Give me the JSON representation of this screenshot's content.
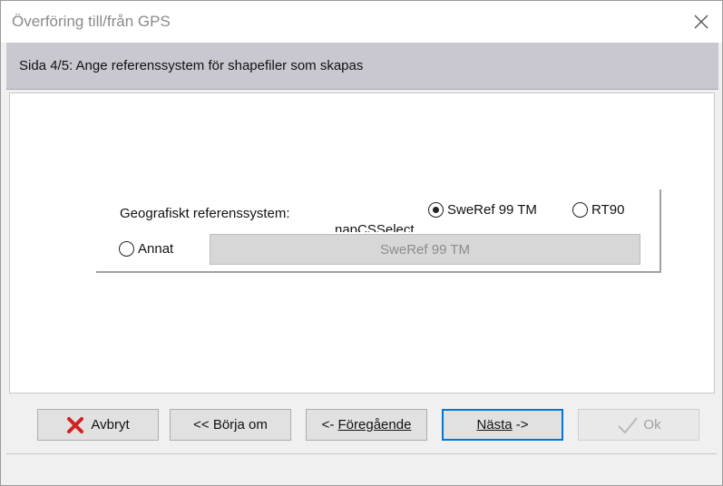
{
  "window": {
    "title": "Överföring till/från GPS"
  },
  "header": {
    "step_text": "Sida 4/5: Ange referenssystem för shapefiler som skapas"
  },
  "reference_group": {
    "label": "Geografiskt referenssystem:",
    "clipped_label": "napCSSelect",
    "options": [
      {
        "label": "SweRef 99 TM",
        "checked": true
      },
      {
        "label": "RT90",
        "checked": false
      },
      {
        "label": "Annat",
        "checked": false
      }
    ],
    "selected_system_display": "SweRef 99 TM"
  },
  "buttons": {
    "cancel": {
      "label": "Avbryt",
      "icon": "red-x-icon"
    },
    "restart": {
      "label": "<< Börja om"
    },
    "previous": {
      "prefix": "<- ",
      "label": "Föregående"
    },
    "next": {
      "label": "Nästa",
      "suffix": " ->"
    },
    "ok": {
      "label": "Ok",
      "icon": "checkmark-icon",
      "enabled": false
    }
  },
  "colors": {
    "header_band": "#c9c8d0",
    "accent_default_button": "#0078d7",
    "cancel_icon": "#d32020"
  }
}
